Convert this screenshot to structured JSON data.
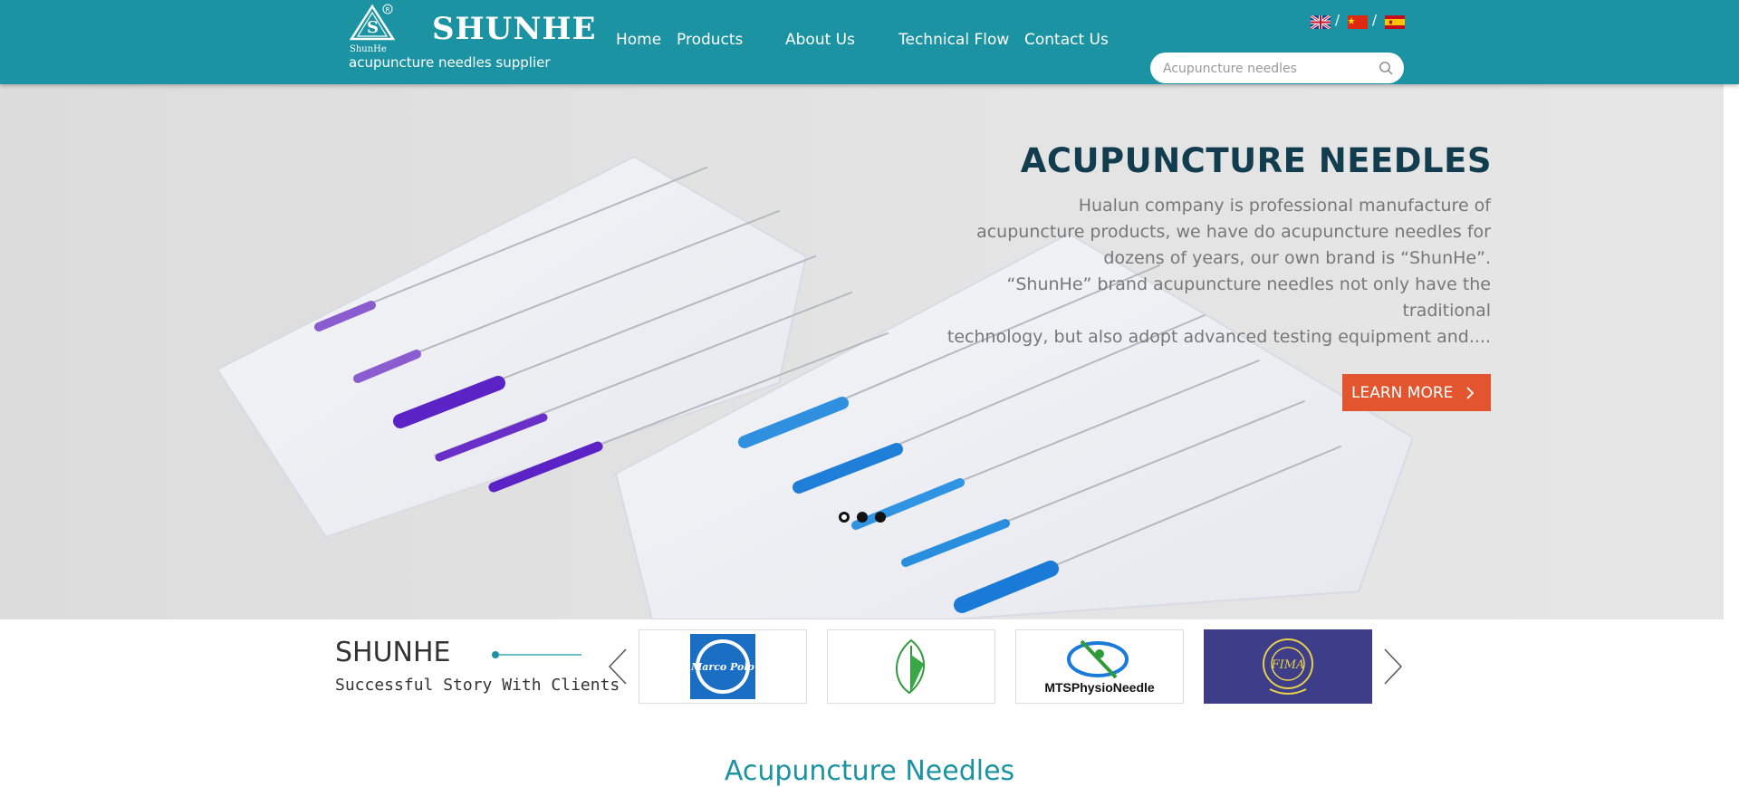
{
  "header": {
    "brand": "SHUNHE",
    "logo_sub": "ShunHe",
    "tagline": "acupuncture needles supplier",
    "nav": [
      "Home",
      "Products",
      "About Us",
      "Technical Flow",
      "Contact Us"
    ],
    "languages": [
      "uk-flag-icon",
      "china-flag-icon",
      "spain-flag-icon"
    ],
    "separator": "/",
    "search": {
      "placeholder": "Acupuncture needles"
    }
  },
  "hero": {
    "title": "ACUPUNCTURE NEEDLES",
    "description": "Hualun company is professional manufacture of acupuncture products, we have do acupuncture needles for dozens of years, our own brand is “ShunHe”. “ShunHe” brand acupuncture needles not only have the traditional technology, but also adopt advanced testing equipment and....",
    "description_lines": [
      "Hualun company is professional manufacture of",
      "acupuncture products, we have do acupuncture needles for",
      "dozens of years, our own brand is “ShunHe”.",
      "“ShunHe” brand acupuncture needles not only have the traditional",
      "technology, but also adopt advanced testing equipment and...."
    ],
    "button": "LEARN MORE",
    "button_icon": "chevron-right-icon",
    "slides": 3,
    "active_slide": 1
  },
  "clients": {
    "title": "SHUNHE",
    "subtitle": "Successful Story With Clients",
    "logos": [
      {
        "name": "marco-polo-logo",
        "text": "Marco Polo"
      },
      {
        "name": "leaf-logo",
        "text": ""
      },
      {
        "name": "mtsphysioneedle-logo",
        "text": "MTSPhysioNeedle"
      },
      {
        "name": "fima-logo",
        "text": "FIMA"
      }
    ],
    "prev_icon": "chevron-left-icon",
    "next_icon": "chevron-right-icon"
  },
  "section": {
    "title": "Acupuncture Needles"
  },
  "colors": {
    "header": "#1b93a3",
    "accent": "#e3552e",
    "heading": "#123d4f",
    "section_title": "#1b93a3"
  }
}
